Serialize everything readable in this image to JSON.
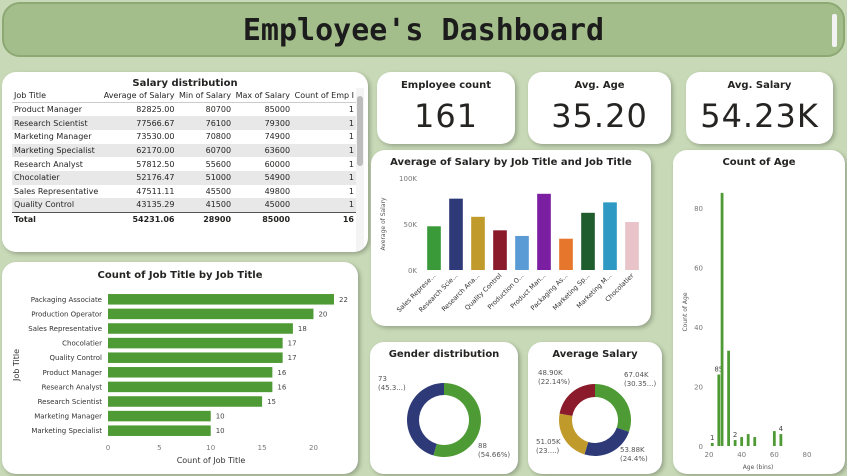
{
  "header": {
    "title": "Employee's Dashboard"
  },
  "salary_table": {
    "title": "Salary distribution",
    "columns": [
      "Job Title",
      "Average of Salary",
      "Min of Salary",
      "Max of Salary",
      "Count of Emp I"
    ],
    "rows": [
      [
        "Product Manager",
        "82825.00",
        "80700",
        "85000",
        "1"
      ],
      [
        "Research Scientist",
        "77566.67",
        "76100",
        "79300",
        "1"
      ],
      [
        "Marketing Manager",
        "73530.00",
        "70800",
        "74900",
        "1"
      ],
      [
        "Marketing Specialist",
        "62170.00",
        "60700",
        "63600",
        "1"
      ],
      [
        "Research Analyst",
        "57812.50",
        "55600",
        "60000",
        "1"
      ],
      [
        "Chocolatier",
        "52176.47",
        "51000",
        "54900",
        "1"
      ],
      [
        "Sales Representative",
        "47511.11",
        "45500",
        "49800",
        "1"
      ],
      [
        "Quality Control",
        "43135.29",
        "41500",
        "45000",
        "1"
      ]
    ],
    "total": [
      "Total",
      "54231.06",
      "28900",
      "85000",
      "16"
    ]
  },
  "kpis": {
    "employee_count": {
      "label": "Employee count",
      "value": "161"
    },
    "avg_age": {
      "label": "Avg. Age",
      "value": "35.20"
    },
    "avg_salary": {
      "label": "Avg. Salary",
      "value": "54.23K"
    }
  },
  "chart_data": [
    {
      "id": "avg_salary_by_job",
      "type": "bar",
      "title": "Average of Salary by Job Title and Job Title",
      "ylabel": "Average of Salary",
      "ylim": [
        0,
        100000
      ],
      "yticks": [
        "0K",
        "50K",
        "100K"
      ],
      "categories": [
        "Sales Represe...",
        "Research Scie...",
        "Research Ana...",
        "Quality Control",
        "Production O...",
        "Product Man...",
        "Packaging As...",
        "Marketing Sp...",
        "Marketing M...",
        "Chocolatier"
      ],
      "values": [
        47511,
        77567,
        57813,
        43135,
        37000,
        82825,
        34000,
        62170,
        73530,
        52176
      ],
      "colors": [
        "#3a9a3a",
        "#2e3a78",
        "#c09a2a",
        "#8b1a2a",
        "#5b9bd5",
        "#7b1fa2",
        "#e5762b",
        "#1f5c2e",
        "#2e9ac4",
        "#e8c4c8"
      ]
    },
    {
      "id": "count_of_age",
      "type": "bar",
      "title": "Count of Age",
      "xlabel": "Age (bins)",
      "ylabel": "Count of Age",
      "xlim": [
        20,
        80
      ],
      "ylim": [
        0,
        90
      ],
      "xticks": [
        20,
        40,
        60,
        80
      ],
      "yticks": [
        0,
        20,
        40,
        60,
        80
      ],
      "bins": [
        22,
        24,
        26,
        28,
        30,
        32,
        34,
        36,
        38,
        40,
        42,
        44,
        46,
        48,
        50,
        52,
        54,
        56,
        58,
        60,
        62,
        64,
        66
      ],
      "values": [
        1,
        0,
        24,
        85,
        0,
        32,
        0,
        2,
        0,
        3,
        0,
        4,
        0,
        3,
        0,
        0,
        0,
        0,
        0,
        5,
        0,
        4,
        0
      ],
      "labeled": {
        "22": "1",
        "26": "85",
        "36": "2",
        "64": "4"
      },
      "color": "#4e9a34"
    },
    {
      "id": "count_job_title",
      "type": "bar",
      "title": "Count of Job Title by Job Title",
      "xlabel": "Count of Job Title",
      "ylabel": "Job Title",
      "xlim": [
        0,
        22
      ],
      "xticks": [
        0,
        5,
        10,
        15,
        20
      ],
      "categories": [
        "Packaging Associate",
        "Production Operator",
        "Sales Representative",
        "Chocolatier",
        "Quality Control",
        "Product Manager",
        "Research Analyst",
        "Research Scientist",
        "Marketing Manager",
        "Marketing Specialist"
      ],
      "values": [
        22,
        20,
        18,
        17,
        17,
        16,
        16,
        15,
        10,
        10
      ],
      "color": "#4e9a34"
    },
    {
      "id": "gender_distribution",
      "type": "pie",
      "title": "Gender distribution",
      "slices": [
        {
          "value": 88,
          "label": "88",
          "pct": "(54.66%)",
          "color": "#4e9a34"
        },
        {
          "value": 73,
          "label": "73",
          "pct": "(45.3...)",
          "color": "#2e3a78"
        }
      ]
    },
    {
      "id": "average_salary_donut",
      "type": "pie",
      "title": "Average Salary",
      "slices": [
        {
          "value": 67.04,
          "label": "67.04K",
          "pct": "(30.35...)",
          "color": "#4e9a34"
        },
        {
          "value": 53.88,
          "label": "53.88K",
          "pct": "(24.4%)",
          "color": "#2e3a78"
        },
        {
          "value": 51.05,
          "label": "51.05K",
          "pct": "(23....)",
          "color": "#c09a2a"
        },
        {
          "value": 48.9,
          "label": "48.90K",
          "pct": "(22.14%)",
          "color": "#8b1a2a"
        }
      ]
    }
  ]
}
